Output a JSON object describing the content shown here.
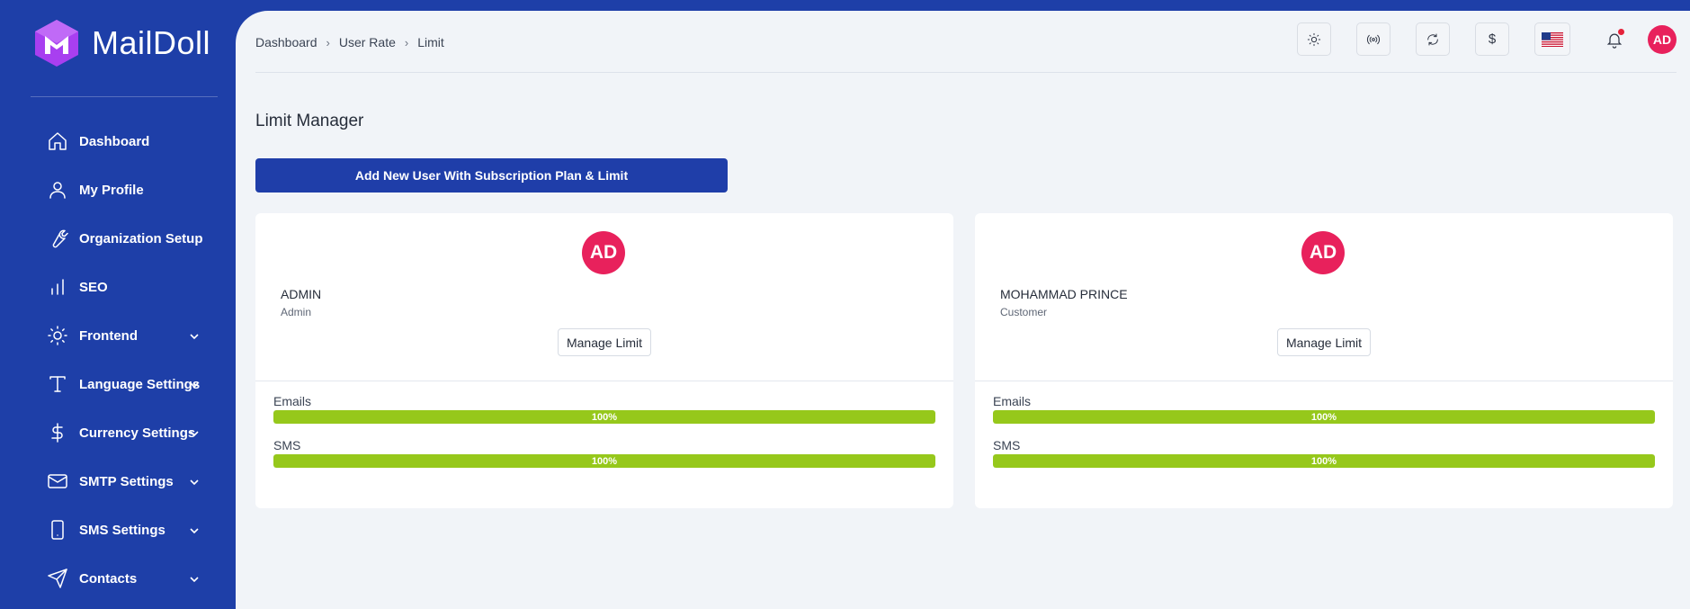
{
  "app": {
    "brand": "MailDoll",
    "colors": {
      "sidebar": "#1e3fa8",
      "accent": "#1f3ea9",
      "avatar": "#e8215c",
      "progress": "#96c81b"
    }
  },
  "sidebar": {
    "items": [
      {
        "label": "Dashboard",
        "icon": "home-icon",
        "has_submenu": false
      },
      {
        "label": "My Profile",
        "icon": "user-icon",
        "has_submenu": false
      },
      {
        "label": "Organization Setup",
        "icon": "wrench-icon",
        "has_submenu": false
      },
      {
        "label": "SEO",
        "icon": "bar-chart-icon",
        "has_submenu": false
      },
      {
        "label": "Frontend",
        "icon": "sun-icon",
        "has_submenu": true
      },
      {
        "label": "Language Settings",
        "icon": "type-icon",
        "has_submenu": true
      },
      {
        "label": "Currency Settings",
        "icon": "dollar-icon",
        "has_submenu": true
      },
      {
        "label": "SMTP Settings",
        "icon": "mail-icon",
        "has_submenu": true
      },
      {
        "label": "SMS Settings",
        "icon": "smartphone-icon",
        "has_submenu": true
      },
      {
        "label": "Contacts",
        "icon": "send-icon",
        "has_submenu": true
      }
    ]
  },
  "breadcrumb": [
    "Dashboard",
    "User Rate",
    "Limit"
  ],
  "topbar": {
    "buttons": [
      "theme-toggle",
      "broadcast",
      "refresh",
      "currency",
      "language"
    ],
    "currency_symbol": "$",
    "avatar_initials": "AD"
  },
  "page": {
    "title": "Limit Manager",
    "add_button_label": "Add New User With Subscription Plan & Limit"
  },
  "users": [
    {
      "initials": "AD",
      "name": "ADMIN",
      "role": "Admin",
      "manage_label": "Manage Limit",
      "meters": [
        {
          "label": "Emails",
          "percent": 100,
          "text": "100%"
        },
        {
          "label": "SMS",
          "percent": 100,
          "text": "100%"
        }
      ]
    },
    {
      "initials": "AD",
      "name": "MOHAMMAD PRINCE",
      "role": "Customer",
      "manage_label": "Manage Limit",
      "meters": [
        {
          "label": "Emails",
          "percent": 100,
          "text": "100%"
        },
        {
          "label": "SMS",
          "percent": 100,
          "text": "100%"
        }
      ]
    }
  ]
}
